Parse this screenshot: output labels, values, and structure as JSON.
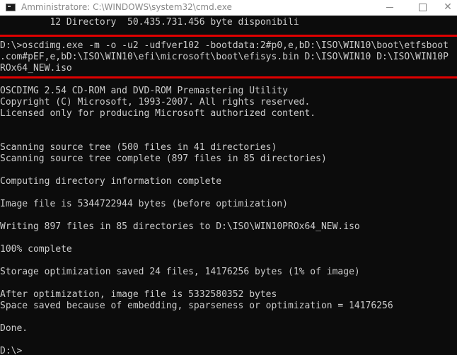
{
  "window": {
    "title": "Amministratore: C:\\WINDOWS\\system32\\cmd.exe",
    "icon": "cmd-icon",
    "controls": [
      "minimize",
      "maximize",
      "close"
    ]
  },
  "console": {
    "lines": [
      "         12 Directory  50.435.731.456 byte disponibili",
      "",
      "D:\\>oscdimg.exe -m -o -u2 -udfver102 -bootdata:2#p0,e,bD:\\ISO\\WIN10\\boot\\etfsboot",
      ".com#pEF,e,bD:\\ISO\\WIN10\\efi\\microsoft\\boot\\efisys.bin D:\\ISO\\WIN10 D:\\ISO\\WIN10P",
      "ROx64_NEW.iso",
      "",
      "OSCDIMG 2.54 CD-ROM and DVD-ROM Premastering Utility",
      "Copyright (C) Microsoft, 1993-2007. All rights reserved.",
      "Licensed only for producing Microsoft authorized content.",
      "",
      "",
      "Scanning source tree (500 files in 41 directories)",
      "Scanning source tree complete (897 files in 85 directories)",
      "",
      "Computing directory information complete",
      "",
      "Image file is 5344722944 bytes (before optimization)",
      "",
      "Writing 897 files in 85 directories to D:\\ISO\\WIN10PROx64_NEW.iso",
      "",
      "100% complete",
      "",
      "Storage optimization saved 24 files, 14176256 bytes (1% of image)",
      "",
      "After optimization, image file is 5332580352 bytes",
      "Space saved because of embedding, sparseness or optimization = 14176256",
      "",
      "Done.",
      "",
      "D:\\>"
    ]
  },
  "colors": {
    "background": "#0c0c0c",
    "text": "#cccccc",
    "highlight": "#e00000",
    "titlebar": "#ffffff"
  }
}
